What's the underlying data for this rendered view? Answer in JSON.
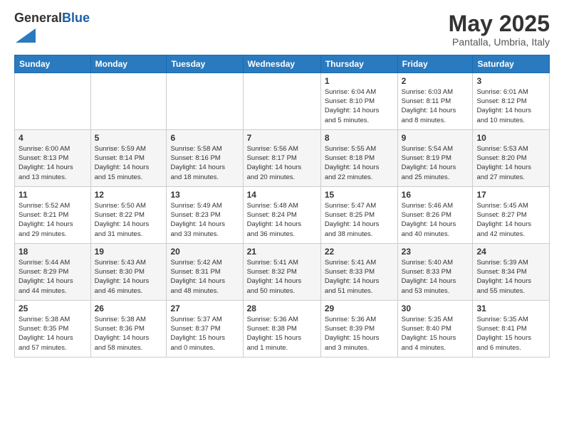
{
  "logo": {
    "general": "General",
    "blue": "Blue"
  },
  "header": {
    "month": "May 2025",
    "location": "Pantalla, Umbria, Italy"
  },
  "weekdays": [
    "Sunday",
    "Monday",
    "Tuesday",
    "Wednesday",
    "Thursday",
    "Friday",
    "Saturday"
  ],
  "weeks": [
    [
      {
        "day": "",
        "info": ""
      },
      {
        "day": "",
        "info": ""
      },
      {
        "day": "",
        "info": ""
      },
      {
        "day": "",
        "info": ""
      },
      {
        "day": "1",
        "info": "Sunrise: 6:04 AM\nSunset: 8:10 PM\nDaylight: 14 hours\nand 5 minutes."
      },
      {
        "day": "2",
        "info": "Sunrise: 6:03 AM\nSunset: 8:11 PM\nDaylight: 14 hours\nand 8 minutes."
      },
      {
        "day": "3",
        "info": "Sunrise: 6:01 AM\nSunset: 8:12 PM\nDaylight: 14 hours\nand 10 minutes."
      }
    ],
    [
      {
        "day": "4",
        "info": "Sunrise: 6:00 AM\nSunset: 8:13 PM\nDaylight: 14 hours\nand 13 minutes."
      },
      {
        "day": "5",
        "info": "Sunrise: 5:59 AM\nSunset: 8:14 PM\nDaylight: 14 hours\nand 15 minutes."
      },
      {
        "day": "6",
        "info": "Sunrise: 5:58 AM\nSunset: 8:16 PM\nDaylight: 14 hours\nand 18 minutes."
      },
      {
        "day": "7",
        "info": "Sunrise: 5:56 AM\nSunset: 8:17 PM\nDaylight: 14 hours\nand 20 minutes."
      },
      {
        "day": "8",
        "info": "Sunrise: 5:55 AM\nSunset: 8:18 PM\nDaylight: 14 hours\nand 22 minutes."
      },
      {
        "day": "9",
        "info": "Sunrise: 5:54 AM\nSunset: 8:19 PM\nDaylight: 14 hours\nand 25 minutes."
      },
      {
        "day": "10",
        "info": "Sunrise: 5:53 AM\nSunset: 8:20 PM\nDaylight: 14 hours\nand 27 minutes."
      }
    ],
    [
      {
        "day": "11",
        "info": "Sunrise: 5:52 AM\nSunset: 8:21 PM\nDaylight: 14 hours\nand 29 minutes."
      },
      {
        "day": "12",
        "info": "Sunrise: 5:50 AM\nSunset: 8:22 PM\nDaylight: 14 hours\nand 31 minutes."
      },
      {
        "day": "13",
        "info": "Sunrise: 5:49 AM\nSunset: 8:23 PM\nDaylight: 14 hours\nand 33 minutes."
      },
      {
        "day": "14",
        "info": "Sunrise: 5:48 AM\nSunset: 8:24 PM\nDaylight: 14 hours\nand 36 minutes."
      },
      {
        "day": "15",
        "info": "Sunrise: 5:47 AM\nSunset: 8:25 PM\nDaylight: 14 hours\nand 38 minutes."
      },
      {
        "day": "16",
        "info": "Sunrise: 5:46 AM\nSunset: 8:26 PM\nDaylight: 14 hours\nand 40 minutes."
      },
      {
        "day": "17",
        "info": "Sunrise: 5:45 AM\nSunset: 8:27 PM\nDaylight: 14 hours\nand 42 minutes."
      }
    ],
    [
      {
        "day": "18",
        "info": "Sunrise: 5:44 AM\nSunset: 8:29 PM\nDaylight: 14 hours\nand 44 minutes."
      },
      {
        "day": "19",
        "info": "Sunrise: 5:43 AM\nSunset: 8:30 PM\nDaylight: 14 hours\nand 46 minutes."
      },
      {
        "day": "20",
        "info": "Sunrise: 5:42 AM\nSunset: 8:31 PM\nDaylight: 14 hours\nand 48 minutes."
      },
      {
        "day": "21",
        "info": "Sunrise: 5:41 AM\nSunset: 8:32 PM\nDaylight: 14 hours\nand 50 minutes."
      },
      {
        "day": "22",
        "info": "Sunrise: 5:41 AM\nSunset: 8:33 PM\nDaylight: 14 hours\nand 51 minutes."
      },
      {
        "day": "23",
        "info": "Sunrise: 5:40 AM\nSunset: 8:33 PM\nDaylight: 14 hours\nand 53 minutes."
      },
      {
        "day": "24",
        "info": "Sunrise: 5:39 AM\nSunset: 8:34 PM\nDaylight: 14 hours\nand 55 minutes."
      }
    ],
    [
      {
        "day": "25",
        "info": "Sunrise: 5:38 AM\nSunset: 8:35 PM\nDaylight: 14 hours\nand 57 minutes."
      },
      {
        "day": "26",
        "info": "Sunrise: 5:38 AM\nSunset: 8:36 PM\nDaylight: 14 hours\nand 58 minutes."
      },
      {
        "day": "27",
        "info": "Sunrise: 5:37 AM\nSunset: 8:37 PM\nDaylight: 15 hours\nand 0 minutes."
      },
      {
        "day": "28",
        "info": "Sunrise: 5:36 AM\nSunset: 8:38 PM\nDaylight: 15 hours\nand 1 minute."
      },
      {
        "day": "29",
        "info": "Sunrise: 5:36 AM\nSunset: 8:39 PM\nDaylight: 15 hours\nand 3 minutes."
      },
      {
        "day": "30",
        "info": "Sunrise: 5:35 AM\nSunset: 8:40 PM\nDaylight: 15 hours\nand 4 minutes."
      },
      {
        "day": "31",
        "info": "Sunrise: 5:35 AM\nSunset: 8:41 PM\nDaylight: 15 hours\nand 6 minutes."
      }
    ]
  ]
}
